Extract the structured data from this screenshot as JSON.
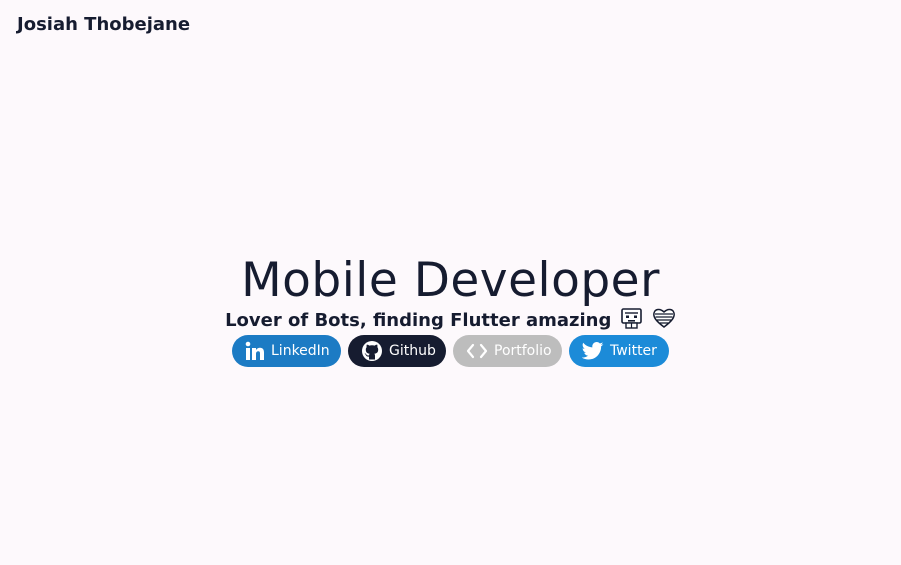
{
  "header": {
    "site_name": "Josiah Thobejane"
  },
  "hero": {
    "headline": "Mobile Developer",
    "tagline": "Lover of Bots, finding Flutter amazing",
    "tagline_emojis": [
      "robot-icon",
      "heart-icon"
    ]
  },
  "links": [
    {
      "label": "LinkedIn",
      "icon": "linkedin-icon",
      "color": "#1c7bc4"
    },
    {
      "label": "Github",
      "icon": "github-icon",
      "color": "#161c30"
    },
    {
      "label": "Portfolio",
      "icon": "code-icon",
      "color": "#bdbdbd"
    },
    {
      "label": "Twitter",
      "icon": "twitter-icon",
      "color": "#1c8bd8"
    }
  ],
  "colors": {
    "background": "#fdf9fc",
    "text": "#161c30"
  }
}
